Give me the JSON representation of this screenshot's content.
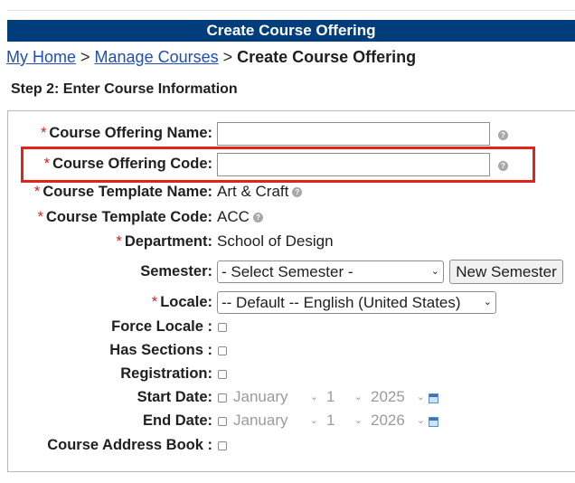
{
  "header": {
    "title": "Create Course Offering"
  },
  "breadcrumb": {
    "home": "My Home",
    "sep1": ">",
    "manage": "Manage Courses",
    "sep2": ">",
    "current": "Create Course Offering"
  },
  "step": "Step 2: Enter Course Information",
  "form": {
    "required_mark": "*",
    "offering_name": {
      "label": "Course Offering Name:",
      "value": ""
    },
    "offering_code": {
      "label": "Course Offering Code:",
      "value": ""
    },
    "template_name": {
      "label": "Course Template Name:",
      "value": "Art & Craft"
    },
    "template_code": {
      "label": "Course Template Code:",
      "value": "ACC"
    },
    "department": {
      "label": "Department:",
      "value": "School of Design"
    },
    "semester": {
      "label": "Semester:",
      "selected": "- Select Semester -",
      "button": "New Semester"
    },
    "locale": {
      "label": "Locale:",
      "selected": "-- Default -- English (United States)"
    },
    "force_locale": {
      "label": "Force Locale :"
    },
    "has_sections": {
      "label": "Has Sections :"
    },
    "registration": {
      "label": "Registration:"
    },
    "start_date": {
      "label": "Start Date:",
      "month": "January",
      "day": "1",
      "year": "2025"
    },
    "end_date": {
      "label": "End Date:",
      "month": "January",
      "day": "1",
      "year": "2026"
    },
    "address_book": {
      "label": "Course Address Book :"
    }
  },
  "icons": {
    "help": "help-icon",
    "calendar": "calendar-icon",
    "dropdown": "chevron-down-icon"
  },
  "colors": {
    "header_bg": "#003d7a",
    "link": "#1f4fb0",
    "required": "#d21e1e",
    "highlight": "#e2231a"
  }
}
